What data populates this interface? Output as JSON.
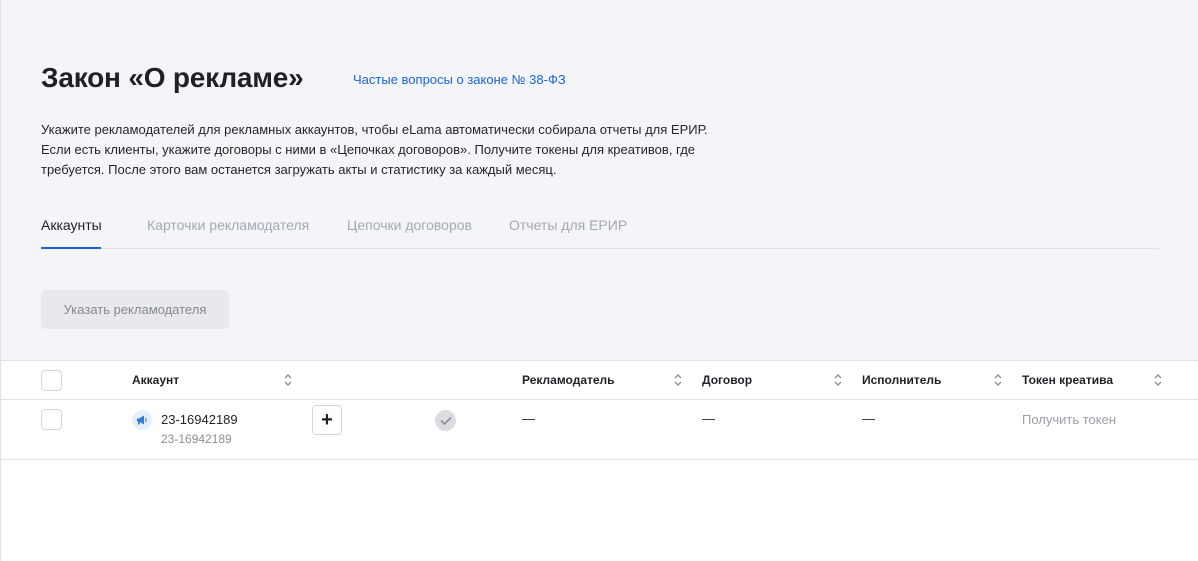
{
  "header": {
    "title": "Закон «О рекламе»",
    "faq_link": "Частые вопросы о законе № 38-ФЗ"
  },
  "description": {
    "line1": "Укажите рекламодателей для рекламных аккаунтов, чтобы eLama автоматически собирала отчеты для ЕРИР.",
    "line2": "Если есть клиенты, укажите договоры с ними в «Цепочках договоров». Получите токены для креативов, где",
    "line3": "требуется. После этого вам останется загружать акты и статистику за каждый месяц."
  },
  "tabs": [
    {
      "label": "Аккаунты",
      "active": true
    },
    {
      "label": "Карточки рекламодателя",
      "active": false
    },
    {
      "label": "Цепочки договоров",
      "active": false
    },
    {
      "label": "Отчеты для ЕРИР",
      "active": false
    }
  ],
  "actions": {
    "specify_advertiser": "Указать рекламодателя"
  },
  "table": {
    "columns": {
      "account": "Аккаунт",
      "advertiser": "Рекламодатель",
      "contract": "Договор",
      "executor": "Исполнитель",
      "creative_token": "Токен креатива"
    },
    "rows": [
      {
        "account_name": "23-16942189",
        "account_id": "23-16942189",
        "advertiser": "—",
        "contract": "—",
        "executor": "—",
        "creative_token": "Получить токен",
        "plus_label": "+"
      }
    ]
  },
  "colors": {
    "accent": "#1b63d6",
    "background_top": "#f4f5f8",
    "muted_text": "#a4a8b1"
  }
}
